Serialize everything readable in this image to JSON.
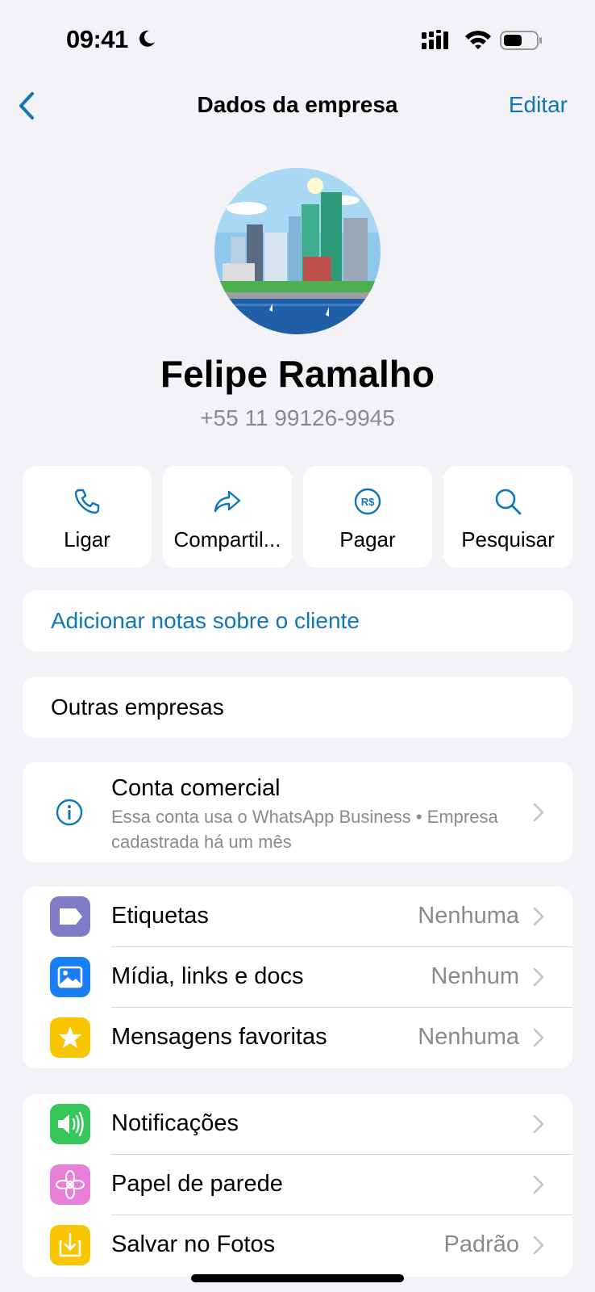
{
  "status_bar": {
    "time": "09:41"
  },
  "nav": {
    "title": "Dados da empresa",
    "edit_label": "Editar"
  },
  "profile": {
    "name": "Felipe Ramalho",
    "phone": "+55 11 99126-9945"
  },
  "actions": [
    {
      "label": "Ligar",
      "icon": "phone-icon"
    },
    {
      "label": "Compartil...",
      "icon": "share-icon"
    },
    {
      "label": "Pagar",
      "icon": "pay-icon"
    },
    {
      "label": "Pesquisar",
      "icon": "search-icon"
    }
  ],
  "notes_label": "Adicionar notas sobre o cliente",
  "others_label": "Outras empresas",
  "business_account": {
    "title": "Conta comercial",
    "description": "Essa conta usa o WhatsApp Business • Empresa cadastrada há um mês"
  },
  "group1": [
    {
      "label": "Etiquetas",
      "value": "Nenhuma",
      "icon": "label-icon",
      "color": "#7d7cc4"
    },
    {
      "label": "Mídia, links e docs",
      "value": "Nenhum",
      "icon": "media-icon",
      "color": "#1a7ef5"
    },
    {
      "label": "Mensagens favoritas",
      "value": "Nenhuma",
      "icon": "star-icon",
      "color": "#f7c600"
    }
  ],
  "group2": [
    {
      "label": "Notificações",
      "value": "",
      "icon": "speaker-icon",
      "color": "#35c759"
    },
    {
      "label": "Papel de parede",
      "value": "",
      "icon": "flower-icon",
      "color": "#e87ed8"
    },
    {
      "label": "Salvar no Fotos",
      "value": "Padrão",
      "icon": "download-icon",
      "color": "#f7c600"
    }
  ],
  "colors": {
    "accent": "#1077b7",
    "background": "#f2f2f7",
    "secondary_text": "#8a8a8e"
  }
}
